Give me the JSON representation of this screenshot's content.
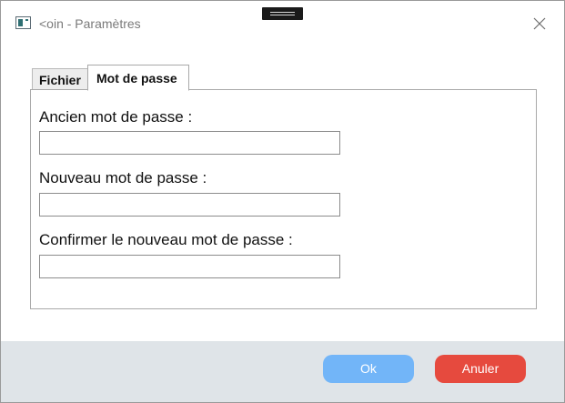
{
  "window": {
    "title": "<oin - Paramètres"
  },
  "tabs": [
    {
      "label": "Fichier",
      "selected": false
    },
    {
      "label": "Mot de passe",
      "selected": true
    }
  ],
  "form": {
    "old_password_label": "Ancien mot de passe :",
    "old_password_value": "",
    "new_password_label": "Nouveau mot de passe :",
    "new_password_value": "",
    "confirm_password_label": "Confirmer le nouveau mot de passe :",
    "confirm_password_value": ""
  },
  "buttons": {
    "ok_label": "Ok",
    "cancel_label": "Anuler"
  },
  "colors": {
    "ok_button": "#72b5f8",
    "cancel_button": "#e64a3e",
    "footer_background": "#dfe4e8"
  },
  "icons": {
    "app": "app-window-icon",
    "close": "close-icon",
    "drag": "drag-handle-icon"
  }
}
